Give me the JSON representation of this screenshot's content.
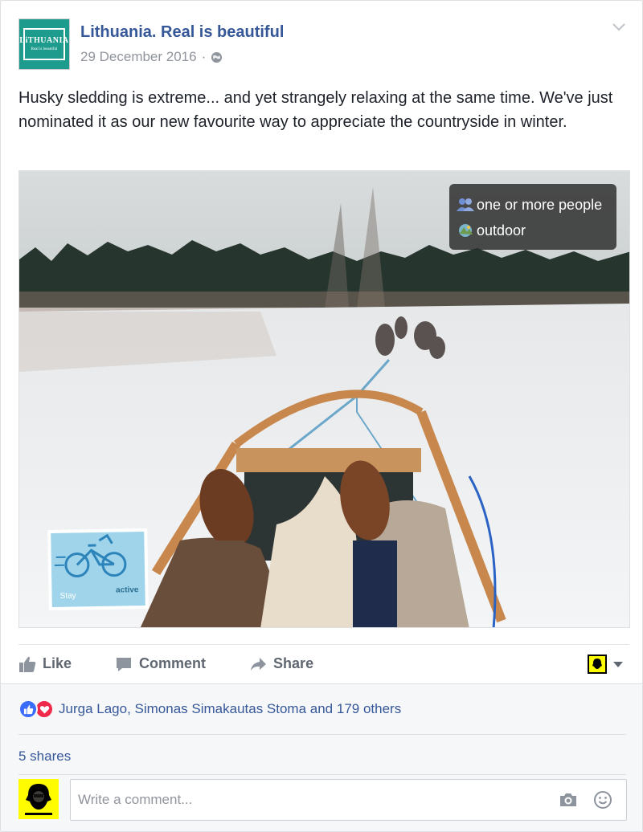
{
  "post": {
    "page_name": "Lithuania. Real is beautiful",
    "logo_text_line1": "LiTHUANIA",
    "logo_text_line2": "Real is beautiful",
    "date": "29 December 2016",
    "separator": "·",
    "privacy_icon": "globe-icon",
    "text": "Husky sledding is extreme... and yet strangely relaxing at the same time. We've just nominated it as our new favourite way to appreciate the countryside in winter."
  },
  "photo": {
    "tags": [
      {
        "icon": "people-icon",
        "label": "one or more people"
      },
      {
        "icon": "outdoor-icon",
        "label": "outdoor"
      }
    ],
    "stamp": {
      "word1": "Stay",
      "word2": "active"
    }
  },
  "actions": {
    "like_label": "Like",
    "comment_label": "Comment",
    "share_label": "Share"
  },
  "feedback": {
    "reactions_text": "Jurga Lago, Simonas Simakautas Stoma and 179 others",
    "shares_text": "5 shares",
    "comment_placeholder": "Write a comment..."
  },
  "colors": {
    "link": "#365899",
    "like_blue": "#3b6dfd",
    "love_red": "#f0284a",
    "snapchat_yellow": "#fffc00"
  }
}
